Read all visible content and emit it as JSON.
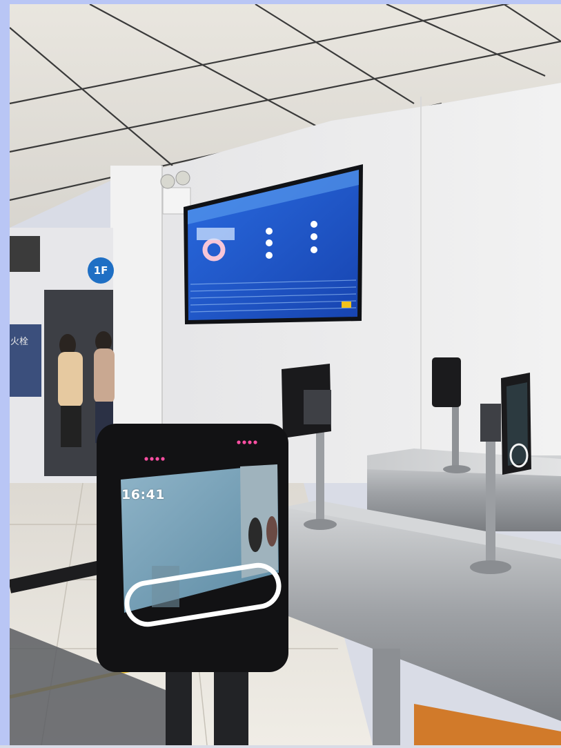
{
  "photo": {
    "terminal_clock": "16:41",
    "floor_sign": "1F",
    "hydrant_sign": "火栓"
  },
  "colors": {
    "wall": "#ececec",
    "ceiling": "#e6e3dc",
    "tv_screen": "#1e55c8",
    "steel": "#a9acb1",
    "terminal_ring": "#ffffff",
    "led": "#ff4fa3"
  }
}
